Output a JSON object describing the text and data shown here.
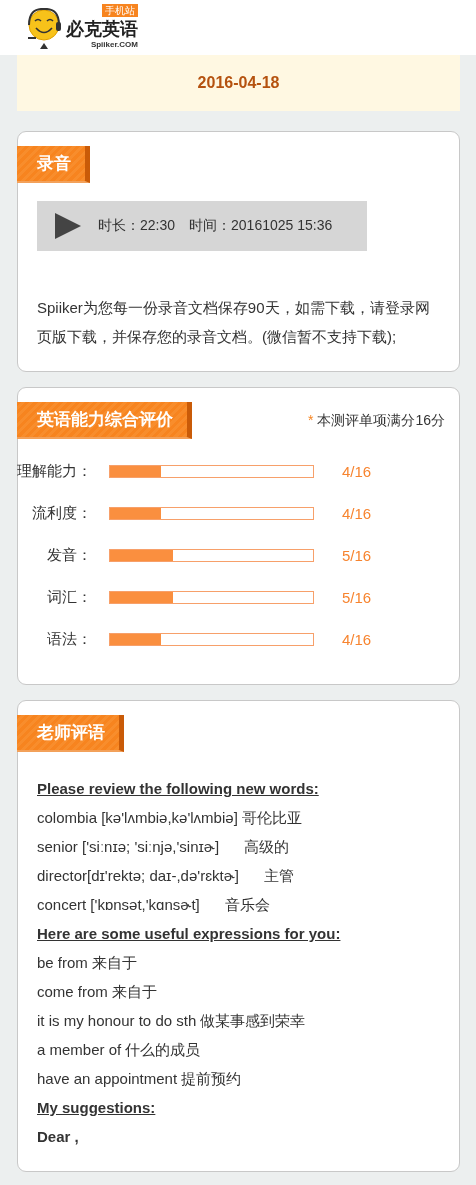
{
  "header": {
    "logo_title": "必克英语",
    "logo_domain": "Spiiker.COM",
    "logo_badge": "手机站"
  },
  "date": "2016-04-18",
  "recording": {
    "title": "录音",
    "duration_label": "时长：22:30",
    "time_label": "时间：20161025 15:36",
    "note": "Spiiker为您每一份录音文档保存90天，如需下载，请登录网页版下载，并保存您的录音文档。(微信暂不支持下载);"
  },
  "evaluation": {
    "title": "英语能力综合评价",
    "note_mark": "*",
    "note": "本测评单项满分16分",
    "items": [
      {
        "label": "理解能力：",
        "level": 0.25,
        "score": "4/16"
      },
      {
        "label": "流利度：",
        "level": 0.25,
        "score": "4/16"
      },
      {
        "label": "发音：",
        "level": 0.3125,
        "score": "5/16"
      },
      {
        "label": "词汇：",
        "level": 0.3125,
        "score": "5/16"
      },
      {
        "label": "语法：",
        "level": 0.25,
        "score": "4/16"
      }
    ]
  },
  "teacher_comments": {
    "title": "老师评语",
    "lines": [
      {
        "kind": "heading",
        "text": "Please review the following new words:"
      },
      {
        "kind": "text",
        "text": "colombia [kə'lʌmbiə,kə'lʌmbiə] 哥伦比亚"
      },
      {
        "kind": "text",
        "text": "senior ['siːnɪə; 'siːnjə,'sinɪɚ]      高级的"
      },
      {
        "kind": "text",
        "text": "director[dɪ'rektə; daɪ-,də'rɛktɚ]      主管"
      },
      {
        "kind": "text",
        "text": "concert ['kɒnsət,'kɑnsɚt]      音乐会"
      },
      {
        "kind": "heading",
        "text": "Here are some useful expressions for you:"
      },
      {
        "kind": "text",
        "text": "be from 来自于"
      },
      {
        "kind": "text",
        "text": "come from 来自于"
      },
      {
        "kind": "text",
        "text": "it is my honour to do sth 做某事感到荣幸"
      },
      {
        "kind": "text",
        "text": "a member of 什么的成员"
      },
      {
        "kind": "text",
        "text": "have an appointment 提前预约"
      },
      {
        "kind": "heading",
        "text": "My suggestions:"
      },
      {
        "kind": "bold",
        "text": "Dear ,"
      }
    ]
  }
}
